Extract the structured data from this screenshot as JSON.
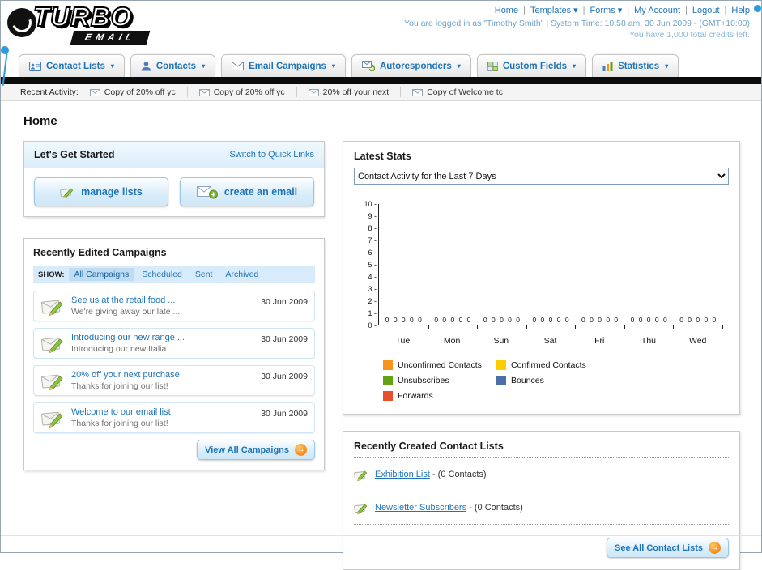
{
  "header": {
    "logo_line1": "TURBO",
    "logo_line2": "EMAIL",
    "links": [
      {
        "label": "Home",
        "caret": false
      },
      {
        "label": "Templates",
        "caret": true
      },
      {
        "label": "Forms",
        "caret": true
      },
      {
        "label": "My Account",
        "caret": false
      },
      {
        "label": "Logout",
        "caret": false
      },
      {
        "label": "Help",
        "caret": false
      }
    ],
    "login_info": "You are logged in as \"Timothy Smith\" | System Time: 10:58 am, 30 Jun 2009 - (GMT+10:00)",
    "credits_info": "You have 1,000 total credits left."
  },
  "nav": {
    "tabs": [
      {
        "label": "Contact Lists",
        "icon": "contact-lists-icon"
      },
      {
        "label": "Contacts",
        "icon": "contacts-icon"
      },
      {
        "label": "Email Campaigns",
        "icon": "email-campaigns-icon"
      },
      {
        "label": "Autoresponders",
        "icon": "autoresponders-icon"
      },
      {
        "label": "Custom Fields",
        "icon": "custom-fields-icon"
      },
      {
        "label": "Statistics",
        "icon": "statistics-icon"
      }
    ]
  },
  "recent_activity": {
    "label": "Recent Activity:",
    "items": [
      "Copy of 20% off yc",
      "Copy of 20% off yc",
      "20% off your next",
      "Copy of Welcome tc"
    ]
  },
  "page": {
    "title": "Home"
  },
  "get_started": {
    "title": "Let's Get Started",
    "switch_link": "Switch to Quick Links",
    "manage_lists_label": "manage lists",
    "create_email_label": "create an email"
  },
  "campaigns": {
    "title": "Recently Edited Campaigns",
    "show_label": "SHOW:",
    "tabs": [
      "All Campaigns",
      "Scheduled",
      "Sent",
      "Archived"
    ],
    "active_tab": "All Campaigns",
    "items": [
      {
        "title": "See us at the retail food ...",
        "subtitle": "We're giving away our late ...",
        "date": "30 Jun 2009"
      },
      {
        "title": "Introducing our new range ...",
        "subtitle": "Introducing our new Italia ...",
        "date": "30 Jun 2009"
      },
      {
        "title": "20% off your next purchase",
        "subtitle": "Thanks for joining our list!",
        "date": "30 Jun 2009"
      },
      {
        "title": "Welcome to our email list",
        "subtitle": "Thanks for joining our list!",
        "date": "30 Jun 2009"
      }
    ],
    "view_all_label": "View All Campaigns"
  },
  "stats": {
    "title": "Latest Stats",
    "selected_option": "Contact Activity for the Last 7 Days"
  },
  "chart_data": {
    "type": "bar",
    "title": "Contact Activity for the Last 7 Days",
    "categories": [
      "Tue",
      "Mon",
      "Sun",
      "Sat",
      "Fri",
      "Thu",
      "Wed"
    ],
    "series": [
      {
        "name": "Unconfirmed Contacts",
        "color": "#F7941E",
        "values": [
          0,
          0,
          0,
          0,
          0,
          0,
          0
        ]
      },
      {
        "name": "Confirmed Contacts",
        "color": "#FFCC00",
        "values": [
          0,
          0,
          0,
          0,
          0,
          0,
          0
        ]
      },
      {
        "name": "Unsubscribes",
        "color": "#61A317",
        "values": [
          0,
          0,
          0,
          0,
          0,
          0,
          0
        ]
      },
      {
        "name": "Bounces",
        "color": "#4D6FA8",
        "values": [
          0,
          0,
          0,
          0,
          0,
          0,
          0
        ]
      },
      {
        "name": "Forwards",
        "color": "#E8502A",
        "values": [
          0,
          0,
          0,
          0,
          0,
          0,
          0
        ]
      }
    ],
    "ylim": [
      0,
      10
    ],
    "ytick_step": 1,
    "grid": false,
    "legend_position": "bottom"
  },
  "contact_lists": {
    "title": "Recently Created Contact Lists",
    "items": [
      {
        "name": "Exhibition List",
        "suffix": "- (0 Contacts)"
      },
      {
        "name": "Newsletter Subscribers",
        "suffix": "- (0 Contacts)"
      }
    ],
    "see_all_label": "See All Contact Lists"
  },
  "colors": {
    "link_blue": "#1F74B8",
    "nav_bar_black": "#0C0C0C",
    "panel_header_blue": "#DBEEFB",
    "accent_orange": "#F7941E"
  }
}
